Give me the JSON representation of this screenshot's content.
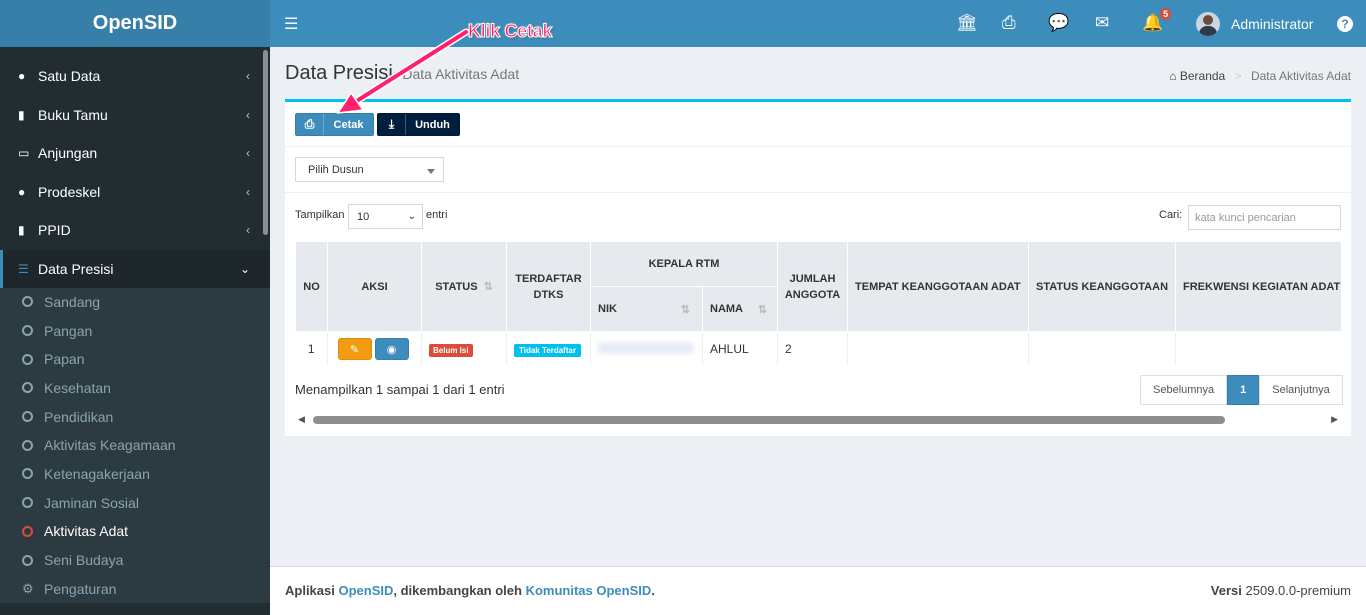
{
  "app": {
    "logo": "OpenSID"
  },
  "sidebar": {
    "items": [
      {
        "label": "Satu Data",
        "icon": "globe-icon"
      },
      {
        "label": "Buku Tamu",
        "icon": "book-icon"
      },
      {
        "label": "Anjungan",
        "icon": "monitor-icon"
      },
      {
        "label": "Prodeskel",
        "icon": "globe-icon"
      },
      {
        "label": "PPID",
        "icon": "book-icon"
      },
      {
        "label": "Data Presisi",
        "icon": "database-icon"
      }
    ],
    "submenu": [
      {
        "label": "Sandang"
      },
      {
        "label": "Pangan"
      },
      {
        "label": "Papan"
      },
      {
        "label": "Kesehatan"
      },
      {
        "label": "Pendidikan"
      },
      {
        "label": "Aktivitas Keagamaan"
      },
      {
        "label": "Ketenagakerjaan"
      },
      {
        "label": "Jaminan Sosial"
      },
      {
        "label": "Aktivitas Adat"
      },
      {
        "label": "Seni Budaya"
      },
      {
        "label": "Pengaturan"
      }
    ]
  },
  "navbar": {
    "username": "Administrator",
    "notif_count": "5",
    "help": "?"
  },
  "header": {
    "title": "Data Presisi",
    "subtitle": "Data Aktivitas Adat"
  },
  "breadcrumb": {
    "home": "Beranda",
    "current": "Data Aktivitas Adat"
  },
  "toolbar": {
    "cetak": "Cetak",
    "unduh": "Unduh"
  },
  "filter": {
    "dusun_placeholder": "Pilih Dusun"
  },
  "datatable": {
    "show_label": "Tampilkan",
    "length_value": "10",
    "entries_label": "entri",
    "search_label": "Cari:",
    "search_placeholder": "kata kunci pencarian",
    "columns": {
      "no": "NO",
      "aksi": "AKSI",
      "status": "STATUS",
      "terdaftar": "TERDAFTAR DTKS",
      "kepala": "KEPALA RTM",
      "nik": "NIK",
      "nama": "NAMA",
      "jumlah": "JUMLAH ANGGOTA",
      "tempat": "TEMPAT KEANGGOTAAN ADAT",
      "status_keanggotaan": "STATUS KEANGGOTAAN",
      "frekwensi": "FREKWENSI KEGIATAN ADAT"
    },
    "rows": [
      {
        "no": "1",
        "status": "Belum Isi",
        "dtks": "Tidak Terdaftar",
        "nama": "AHLUL",
        "jumlah": "2"
      }
    ],
    "info": "Menampilkan 1 sampai 1 dari 1 entri",
    "pager": {
      "prev": "Sebelumnya",
      "page": "1",
      "next": "Selanjutnya"
    }
  },
  "annotation": {
    "text": "Klik Cetak"
  },
  "footer": {
    "prefix": "Aplikasi ",
    "app_link": "OpenSID",
    "middle": ", dikembangkan oleh ",
    "community_link": "Komunitas OpenSID",
    "suffix": ".",
    "version_label": "Versi",
    "version": "2509.0.0-premium"
  },
  "colors": {
    "primary": "#3c8dbc",
    "sidebar": "#222d32",
    "annotation": "#ff1f6b"
  }
}
